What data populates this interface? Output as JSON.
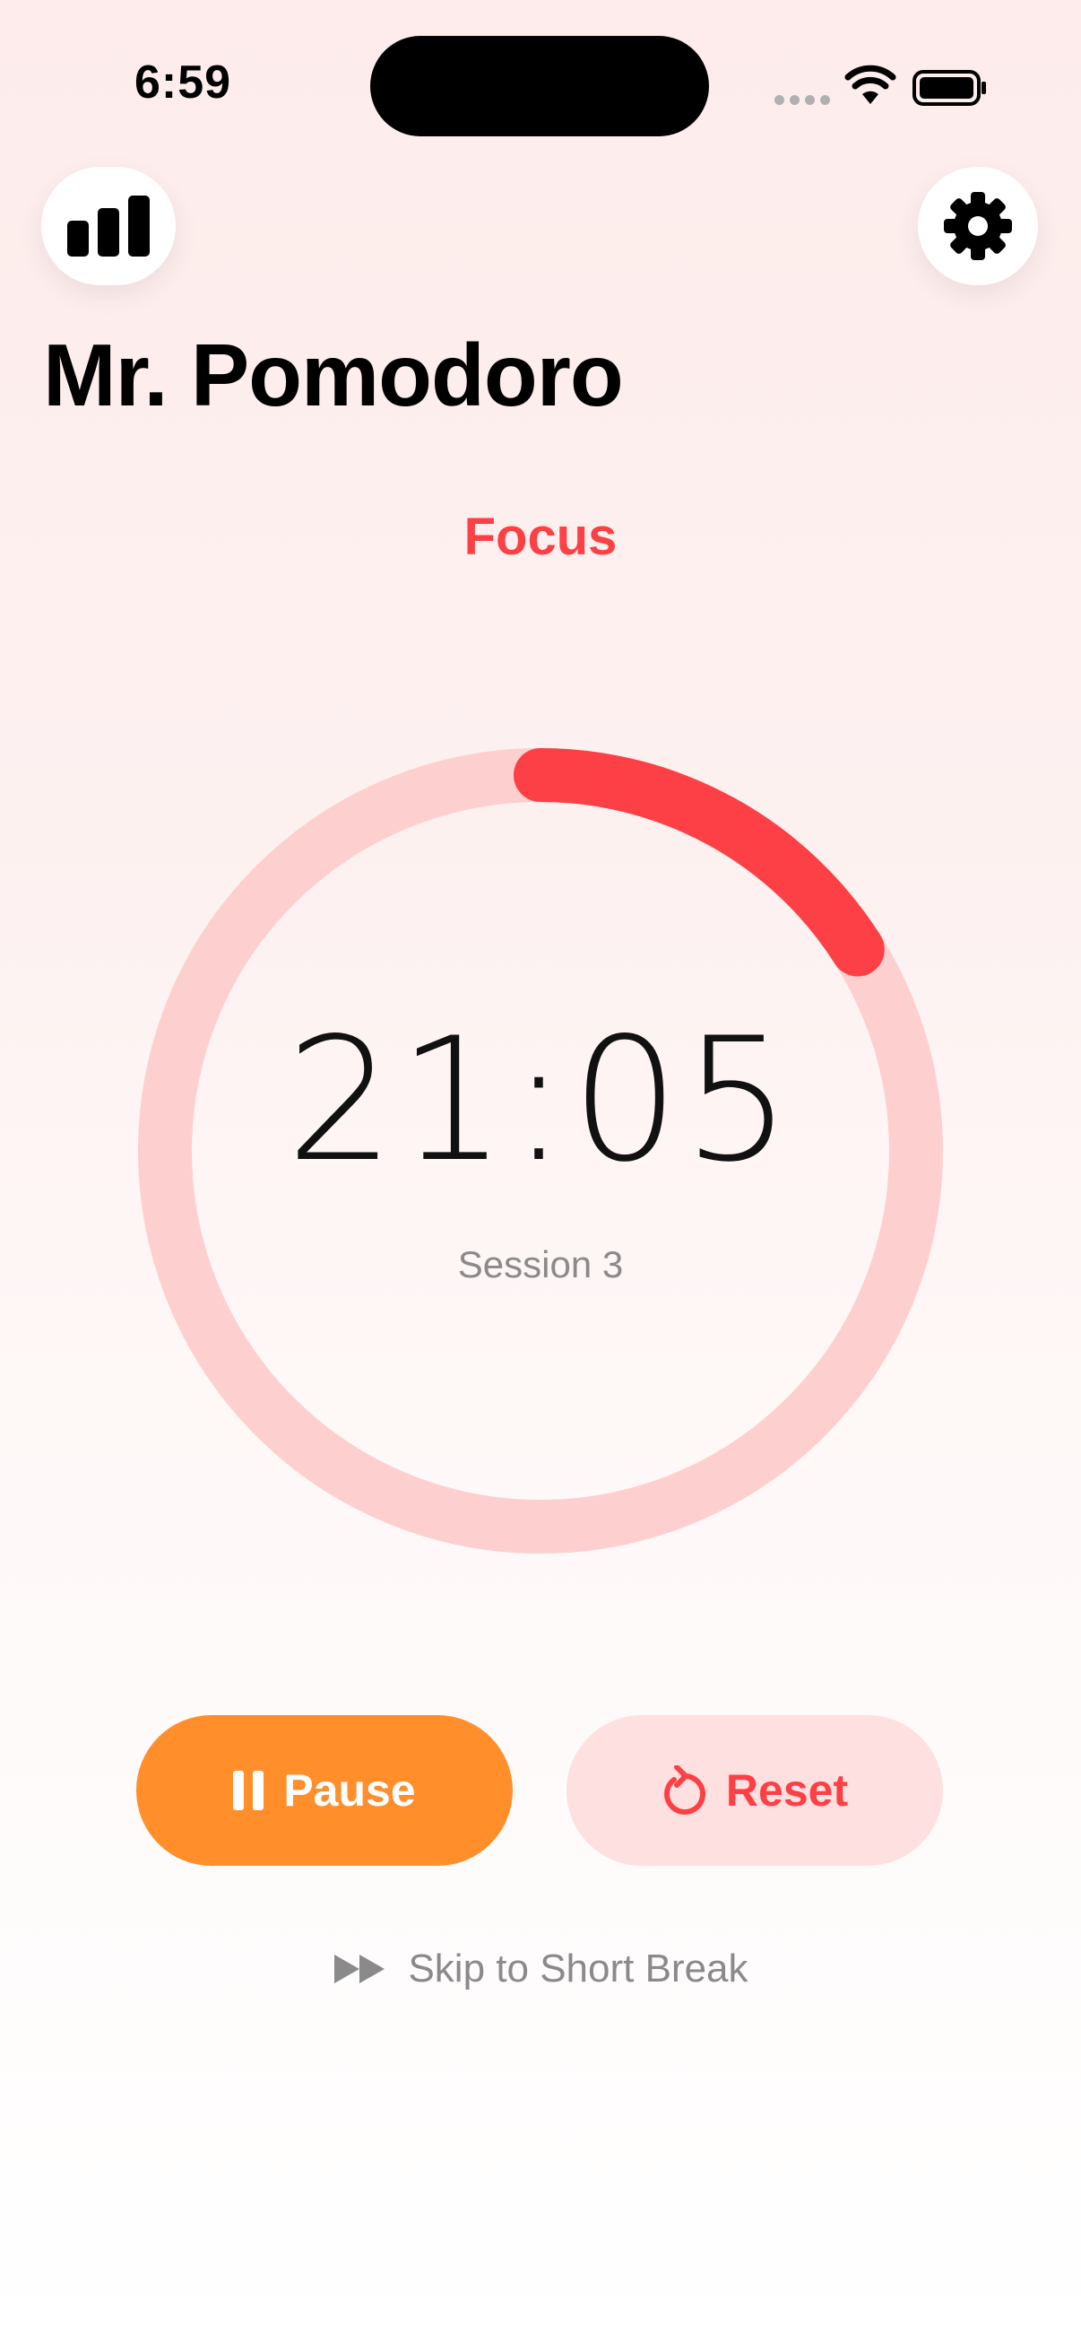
{
  "status_bar": {
    "time": "6:59"
  },
  "header": {
    "stats_icon": "chart-bars-icon",
    "settings_icon": "gear-icon",
    "title": "Mr. Pomodoro"
  },
  "timer": {
    "mode": "Focus",
    "time_remaining": "21:05",
    "session": "Session 3",
    "progress_fraction": 0.16,
    "colors": {
      "accent": "#fc4045",
      "track": "#fdd0cf"
    }
  },
  "actions": {
    "pause_label": "Pause",
    "pause_icon": "pause-icon",
    "reset_label": "Reset",
    "reset_icon": "reset-icon",
    "skip_label": "Skip to Short Break",
    "skip_icon": "fast-forward-icon",
    "colors": {
      "pause_bg": "#ff8e2b",
      "reset_bg": "#fde0df"
    }
  }
}
